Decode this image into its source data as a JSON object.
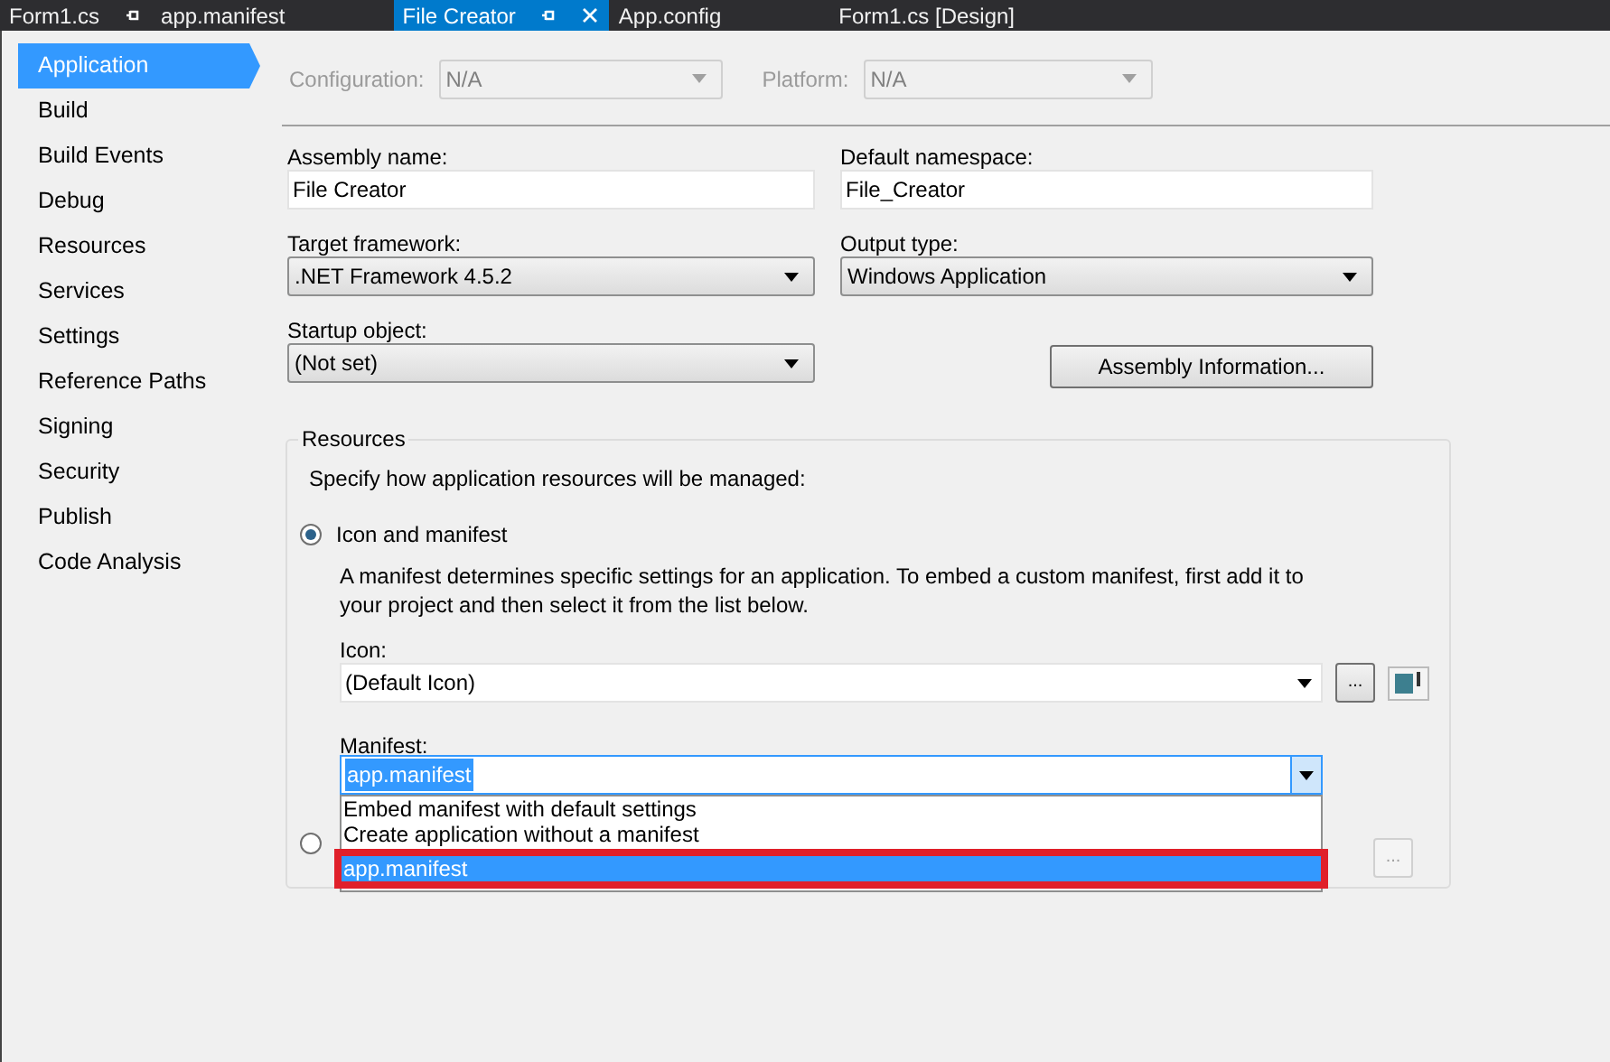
{
  "tabs": [
    {
      "label": "Form1.cs",
      "selected": false,
      "pin": true,
      "close": false
    },
    {
      "label": "app.manifest",
      "selected": false,
      "pin": false,
      "close": false
    },
    {
      "label": "File Creator",
      "selected": true,
      "pin": true,
      "close": true
    },
    {
      "label": "App.config",
      "selected": false,
      "pin": false,
      "close": false
    },
    {
      "label": "Form1.cs [Design]",
      "selected": false,
      "pin": false,
      "close": false
    }
  ],
  "sidebar": {
    "items": [
      {
        "label": "Application",
        "selected": true
      },
      {
        "label": "Build",
        "selected": false
      },
      {
        "label": "Build Events",
        "selected": false
      },
      {
        "label": "Debug",
        "selected": false
      },
      {
        "label": "Resources",
        "selected": false
      },
      {
        "label": "Services",
        "selected": false
      },
      {
        "label": "Settings",
        "selected": false
      },
      {
        "label": "Reference Paths",
        "selected": false
      },
      {
        "label": "Signing",
        "selected": false
      },
      {
        "label": "Security",
        "selected": false
      },
      {
        "label": "Publish",
        "selected": false
      },
      {
        "label": "Code Analysis",
        "selected": false
      }
    ]
  },
  "config": {
    "configuration_label": "Configuration:",
    "configuration_value": "N/A",
    "platform_label": "Platform:",
    "platform_value": "N/A",
    "disabled": true
  },
  "assembly_name": {
    "label": "Assembly name:",
    "value": "File Creator"
  },
  "default_namespace": {
    "label": "Default namespace:",
    "value": "File_Creator"
  },
  "target_framework": {
    "label": "Target framework:",
    "value": ".NET Framework 4.5.2"
  },
  "output_type": {
    "label": "Output type:",
    "value": "Windows Application"
  },
  "startup_object": {
    "label": "Startup object:",
    "value": "(Not set)"
  },
  "assembly_info_button": "Assembly Information...",
  "resources": {
    "title": "Resources",
    "description": "Specify how application resources will be managed:",
    "options": [
      {
        "label": "Icon and manifest",
        "selected": true
      },
      {
        "selected": false
      }
    ],
    "manifest_note": "A manifest determines specific settings for an application. To embed a custom manifest, first add it to your project and then select it from the list below.",
    "icon": {
      "label": "Icon:",
      "value": "(Default Icon)",
      "browse": "..."
    },
    "manifest": {
      "label": "Manifest:",
      "value": "app.manifest",
      "expanded": true,
      "options": [
        {
          "label": "Embed manifest with default settings",
          "selected": false,
          "highlighted": false
        },
        {
          "label": "Create application without a manifest",
          "selected": false,
          "highlighted": false
        },
        {
          "label": "app.manifest",
          "selected": true,
          "highlighted": true
        }
      ]
    },
    "resource_file_browse": {
      "label": "...",
      "disabled": true
    }
  }
}
